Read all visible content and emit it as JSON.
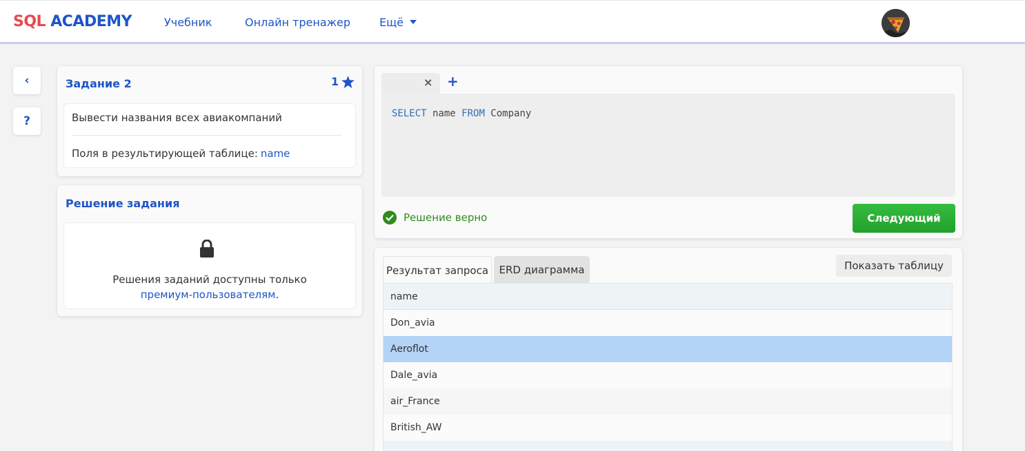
{
  "header": {
    "logo_sql": "SQL",
    "logo_academy": "ACADEMY",
    "nav": {
      "tutorial": "Учебник",
      "trainer": "Онлайн тренажер",
      "more": "Ещё"
    }
  },
  "side": {
    "back_icon": "‹",
    "help_icon": "?"
  },
  "task": {
    "title": "Задание 2",
    "stars": "1",
    "description": "Вывести названия всех авиакомпаний",
    "fields_label": "Поля в результирующей таблице:",
    "fields_value": "name"
  },
  "solution": {
    "title": "Решение задания",
    "locked_text": "Решения заданий доступны только",
    "premium_link": "премиум-пользователям",
    "period": "."
  },
  "editor": {
    "tab_close": "×",
    "tab_add": "+",
    "code": {
      "kw1": "SELECT",
      "ident1": " name ",
      "kw2": "FROM",
      "ident2": " Company"
    },
    "status": "Решение верно",
    "next_label": "Следующий"
  },
  "results": {
    "tab_result": "Результат запроса",
    "tab_erd": "ERD диаграмма",
    "show_table": "Показать таблицу",
    "columns": [
      "name"
    ],
    "rows": [
      "Don_avia",
      "Aeroflot",
      "Dale_avia",
      "air_France",
      "British_AW"
    ],
    "selected_row": "Aeroflot"
  },
  "colors": {
    "accent": "#1f55c6",
    "logo_red": "#e8484f",
    "success": "#2e8b1c",
    "next_button": "#2fb33a",
    "selected_row": "#b3d3f7"
  }
}
